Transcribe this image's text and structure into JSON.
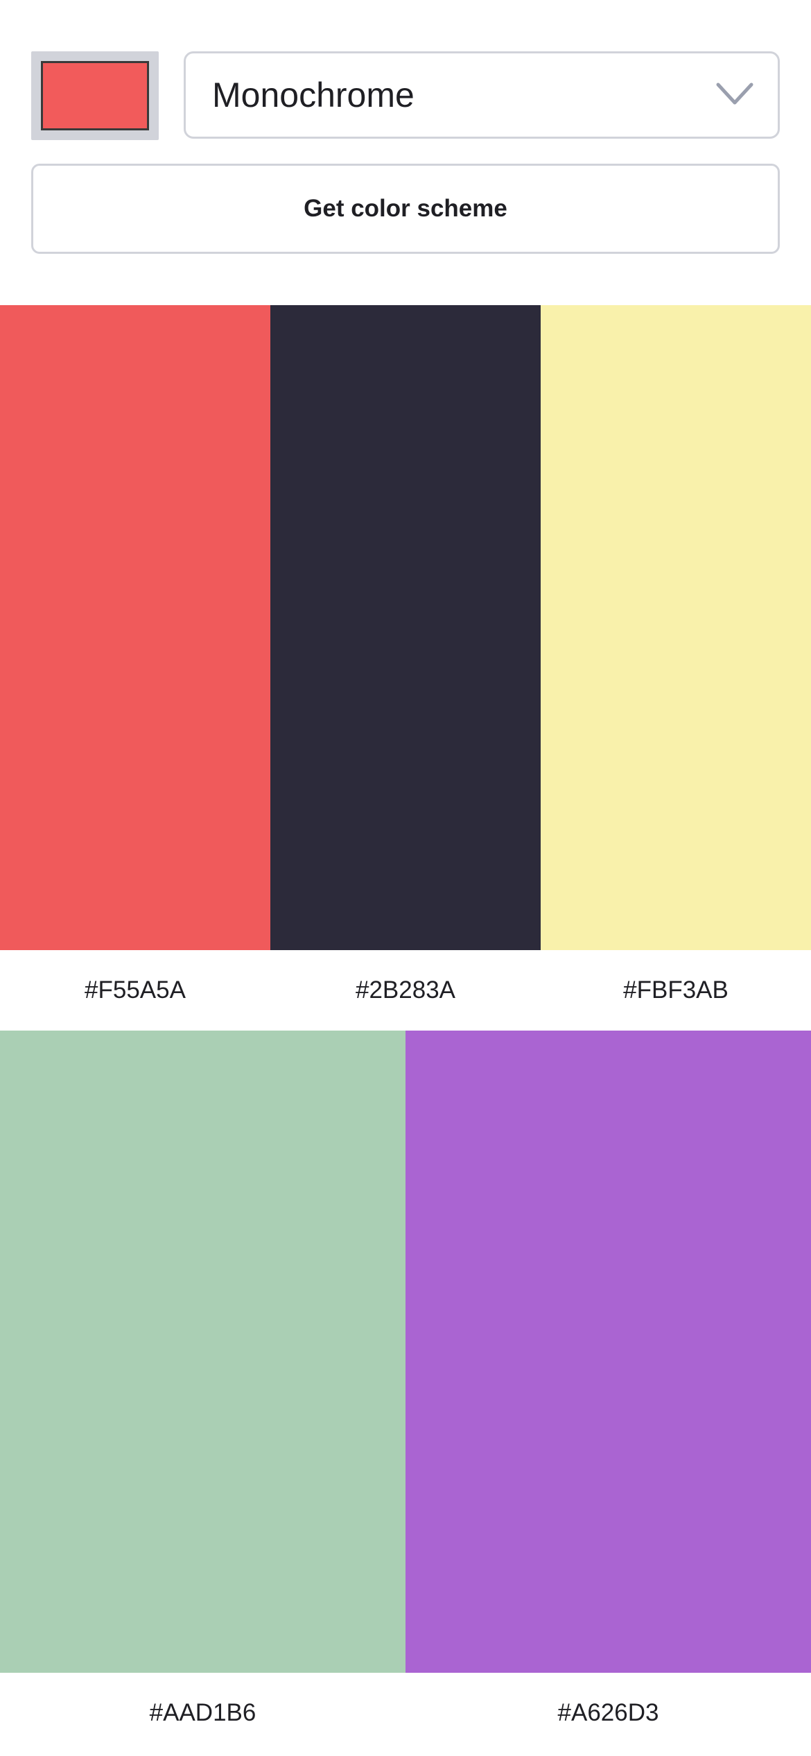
{
  "controls": {
    "seed_color": "#F25B5B",
    "mode_select": {
      "value": "Monochrome"
    },
    "get_scheme_label": "Get color scheme"
  },
  "palette": {
    "colors": [
      {
        "hex": "#F55A5A",
        "swatch": "#F05A5B"
      },
      {
        "hex": "#2B283A",
        "swatch": "#2C2A3A"
      },
      {
        "hex": "#FBF3AB",
        "swatch": "#F9F1AB"
      },
      {
        "hex": "#AAD1B6",
        "swatch": "#AACFB4"
      },
      {
        "hex": "#A626D3",
        "swatch": "#AA64D2"
      }
    ]
  },
  "icons": {
    "select_chevron": "chevron-down-icon"
  },
  "colors": {
    "border": "#D1D3DA",
    "text": "#1F1F24",
    "chevron": "#9A9FAE"
  }
}
